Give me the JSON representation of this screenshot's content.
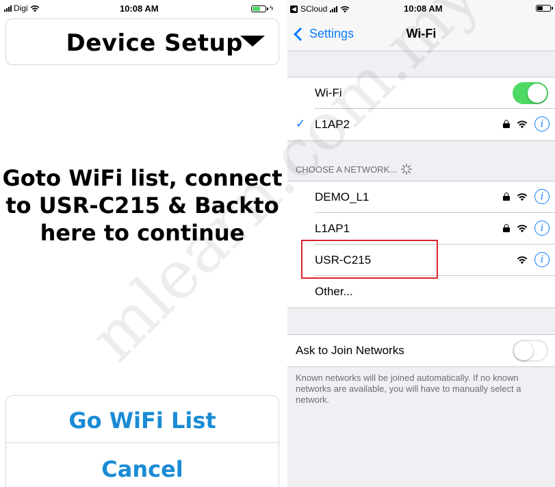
{
  "left_screen": {
    "status_bar": {
      "carrier": "Digi",
      "time": "10:08 AM"
    },
    "header": {
      "title": "Device Setup",
      "menu_icon": "triangle-down-icon"
    },
    "instruction_lines": [
      "Goto WiFi list, connect",
      "to USR-C215 & Backto",
      "here to continue"
    ],
    "buttons": {
      "go_wifi_list": "Go WiFi List",
      "cancel": "Cancel"
    },
    "colors": {
      "button_text": "#1a8bd4",
      "battery_fill": "#4cd964"
    }
  },
  "right_screen": {
    "status_bar": {
      "carrier": "SCloud",
      "time": "10:08 AM",
      "back_badge_icon": "back-arrow-icon"
    },
    "nav": {
      "back_label": "Settings",
      "title": "Wi-Fi"
    },
    "wifi_toggle": {
      "label": "Wi-Fi",
      "on": true
    },
    "connected_network": {
      "name": "L1AP2",
      "secured": true,
      "checkmark": "✓"
    },
    "choose_header": "CHOOSE A NETWORK...",
    "networks": [
      {
        "name": "DEMO_L1",
        "secured": true,
        "info": "i"
      },
      {
        "name": "L1AP1",
        "secured": true,
        "info": "i"
      },
      {
        "name": "USR-C215",
        "secured": false,
        "info": "i",
        "highlighted": true
      }
    ],
    "other_label": "Other...",
    "ask_to_join": {
      "label": "Ask to Join Networks",
      "on": false
    },
    "footnote": "Known networks will be joined automatically. If no known networks are available, you will have to manually select a network.",
    "colors": {
      "accent": "#0a7aff",
      "toggle_on": "#4cd964",
      "highlight_box": "#d9252b",
      "section_text": "#6d6d72"
    }
  },
  "watermark": "mlearn.com.my"
}
